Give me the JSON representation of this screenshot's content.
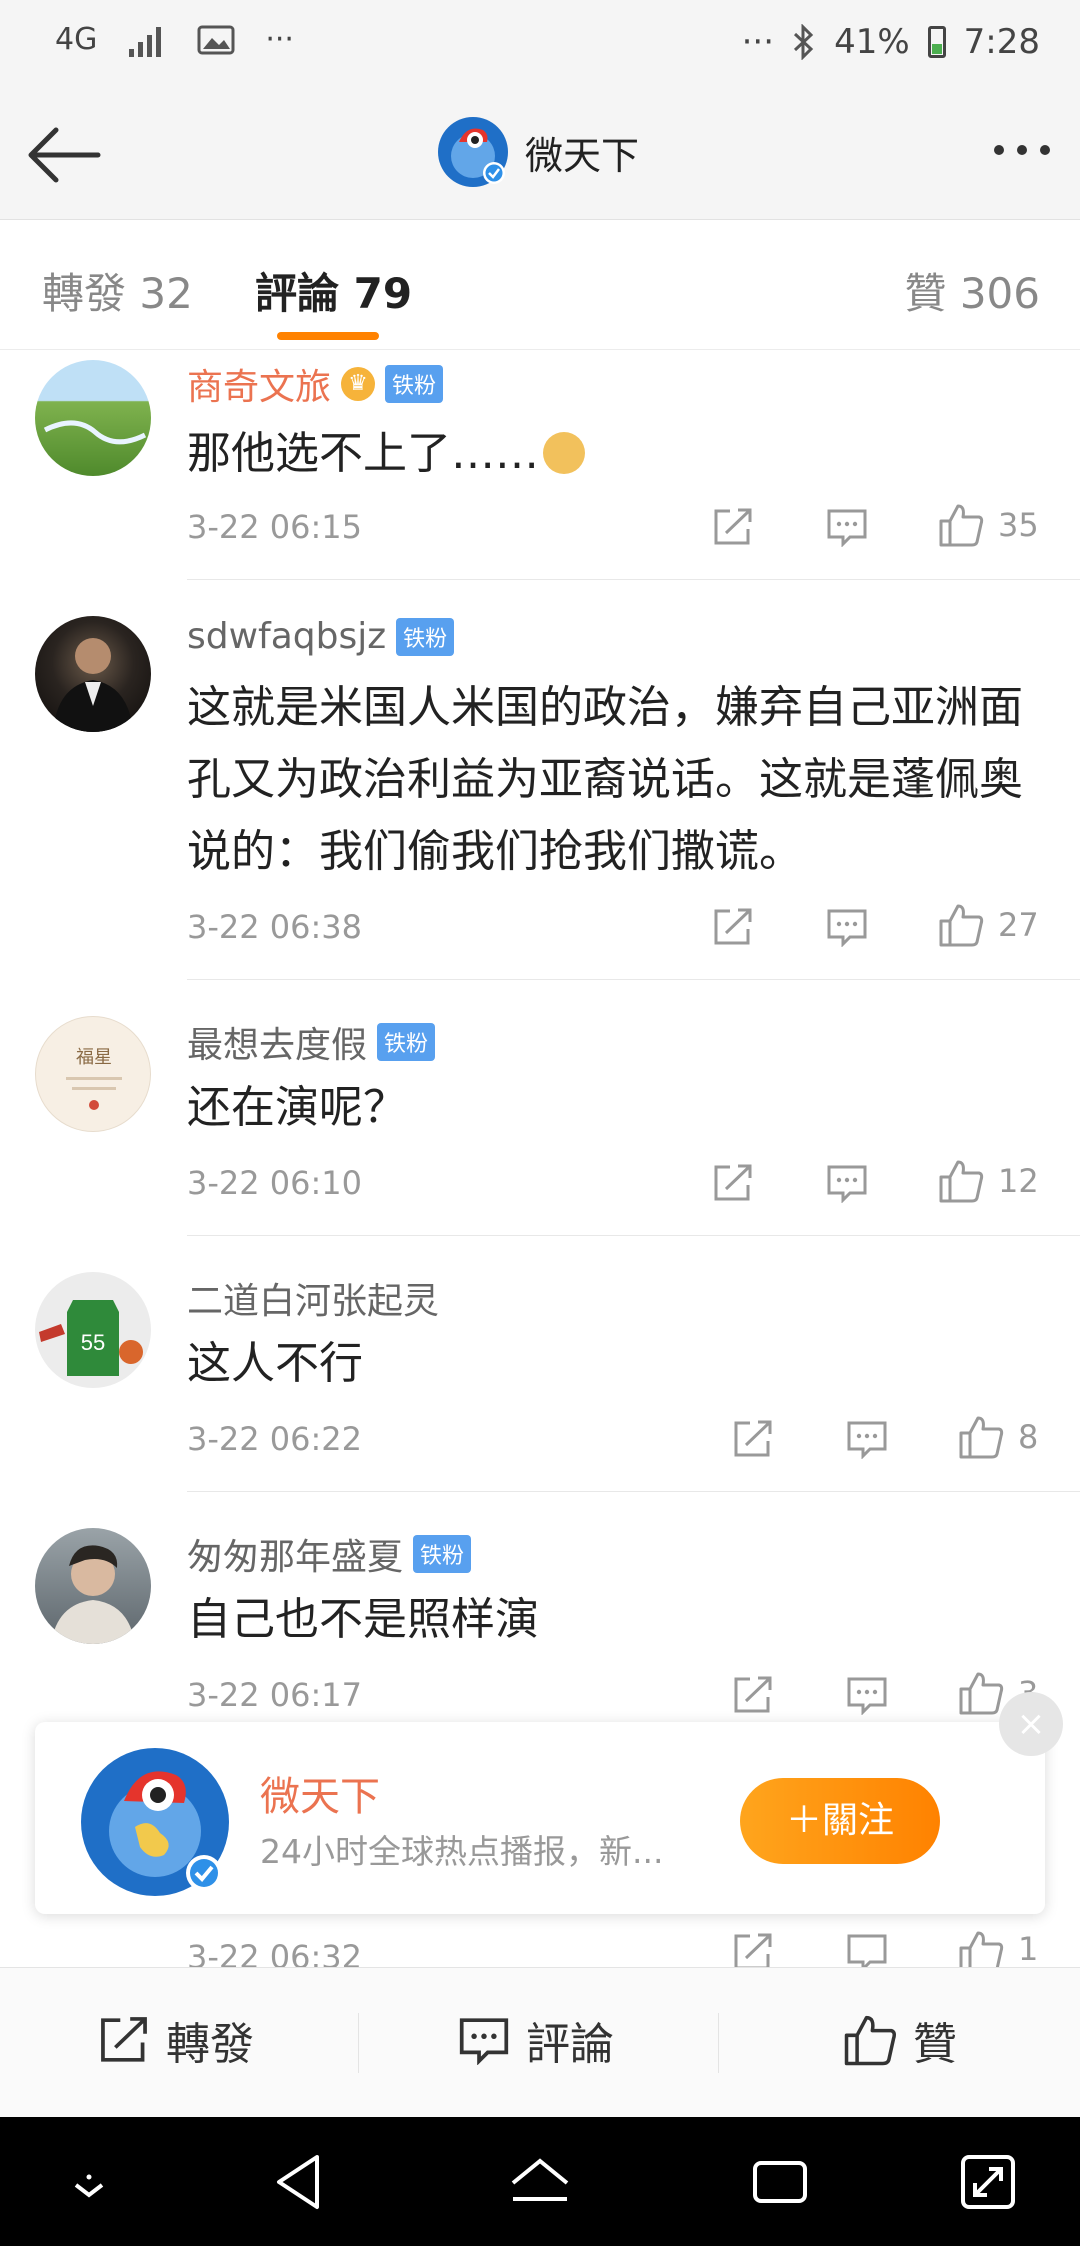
{
  "status_bar": {
    "network": "4G",
    "dots_left": "···",
    "dots_right": "···",
    "battery": "41%",
    "time": "7:28"
  },
  "nav": {
    "title": "微天下"
  },
  "tabs": [
    {
      "label": "轉發 32"
    },
    {
      "label": "評論 79"
    },
    {
      "label": "贊 306"
    }
  ],
  "comments": [
    {
      "name": "商奇文旅",
      "badge": "铁粉",
      "text": "那他选不上了……",
      "time": "3-22 06:15",
      "likes": "35"
    },
    {
      "name": "sdwfaqbsjz",
      "badge": "铁粉",
      "text": "这就是米国人米国的政治，嫌弃自己亚洲面孔又为政治利益为亚裔说话。这就是蓬佩奥说的：我们偷我们抢我们撒谎。",
      "time": "3-22 06:38",
      "likes": "27"
    },
    {
      "name": "最想去度假",
      "badge": "铁粉",
      "text": "还在演呢？",
      "time": "3-22 06:10",
      "likes": "12"
    },
    {
      "name": "二道白河张起灵",
      "text": "这人不行",
      "time": "3-22 06:22",
      "likes": "8"
    },
    {
      "name": "匆匆那年盛夏",
      "badge": "铁粉",
      "text": "自己也不是照样演",
      "time": "3-22 06:17",
      "likes": "3"
    },
    {
      "time": "3-22 06:32",
      "likes": "1"
    }
  ],
  "follow_card": {
    "name": "微天下",
    "description": "24小时全球热点播报，新...",
    "follow_label": "＋關注"
  },
  "bottom_bar": {
    "repost": "轉發",
    "comment": "評論",
    "like": "贊"
  },
  "colors": {
    "accent": "#ff8200",
    "name_highlight": "#eb7350",
    "badge_blue": "#58a0ef"
  }
}
